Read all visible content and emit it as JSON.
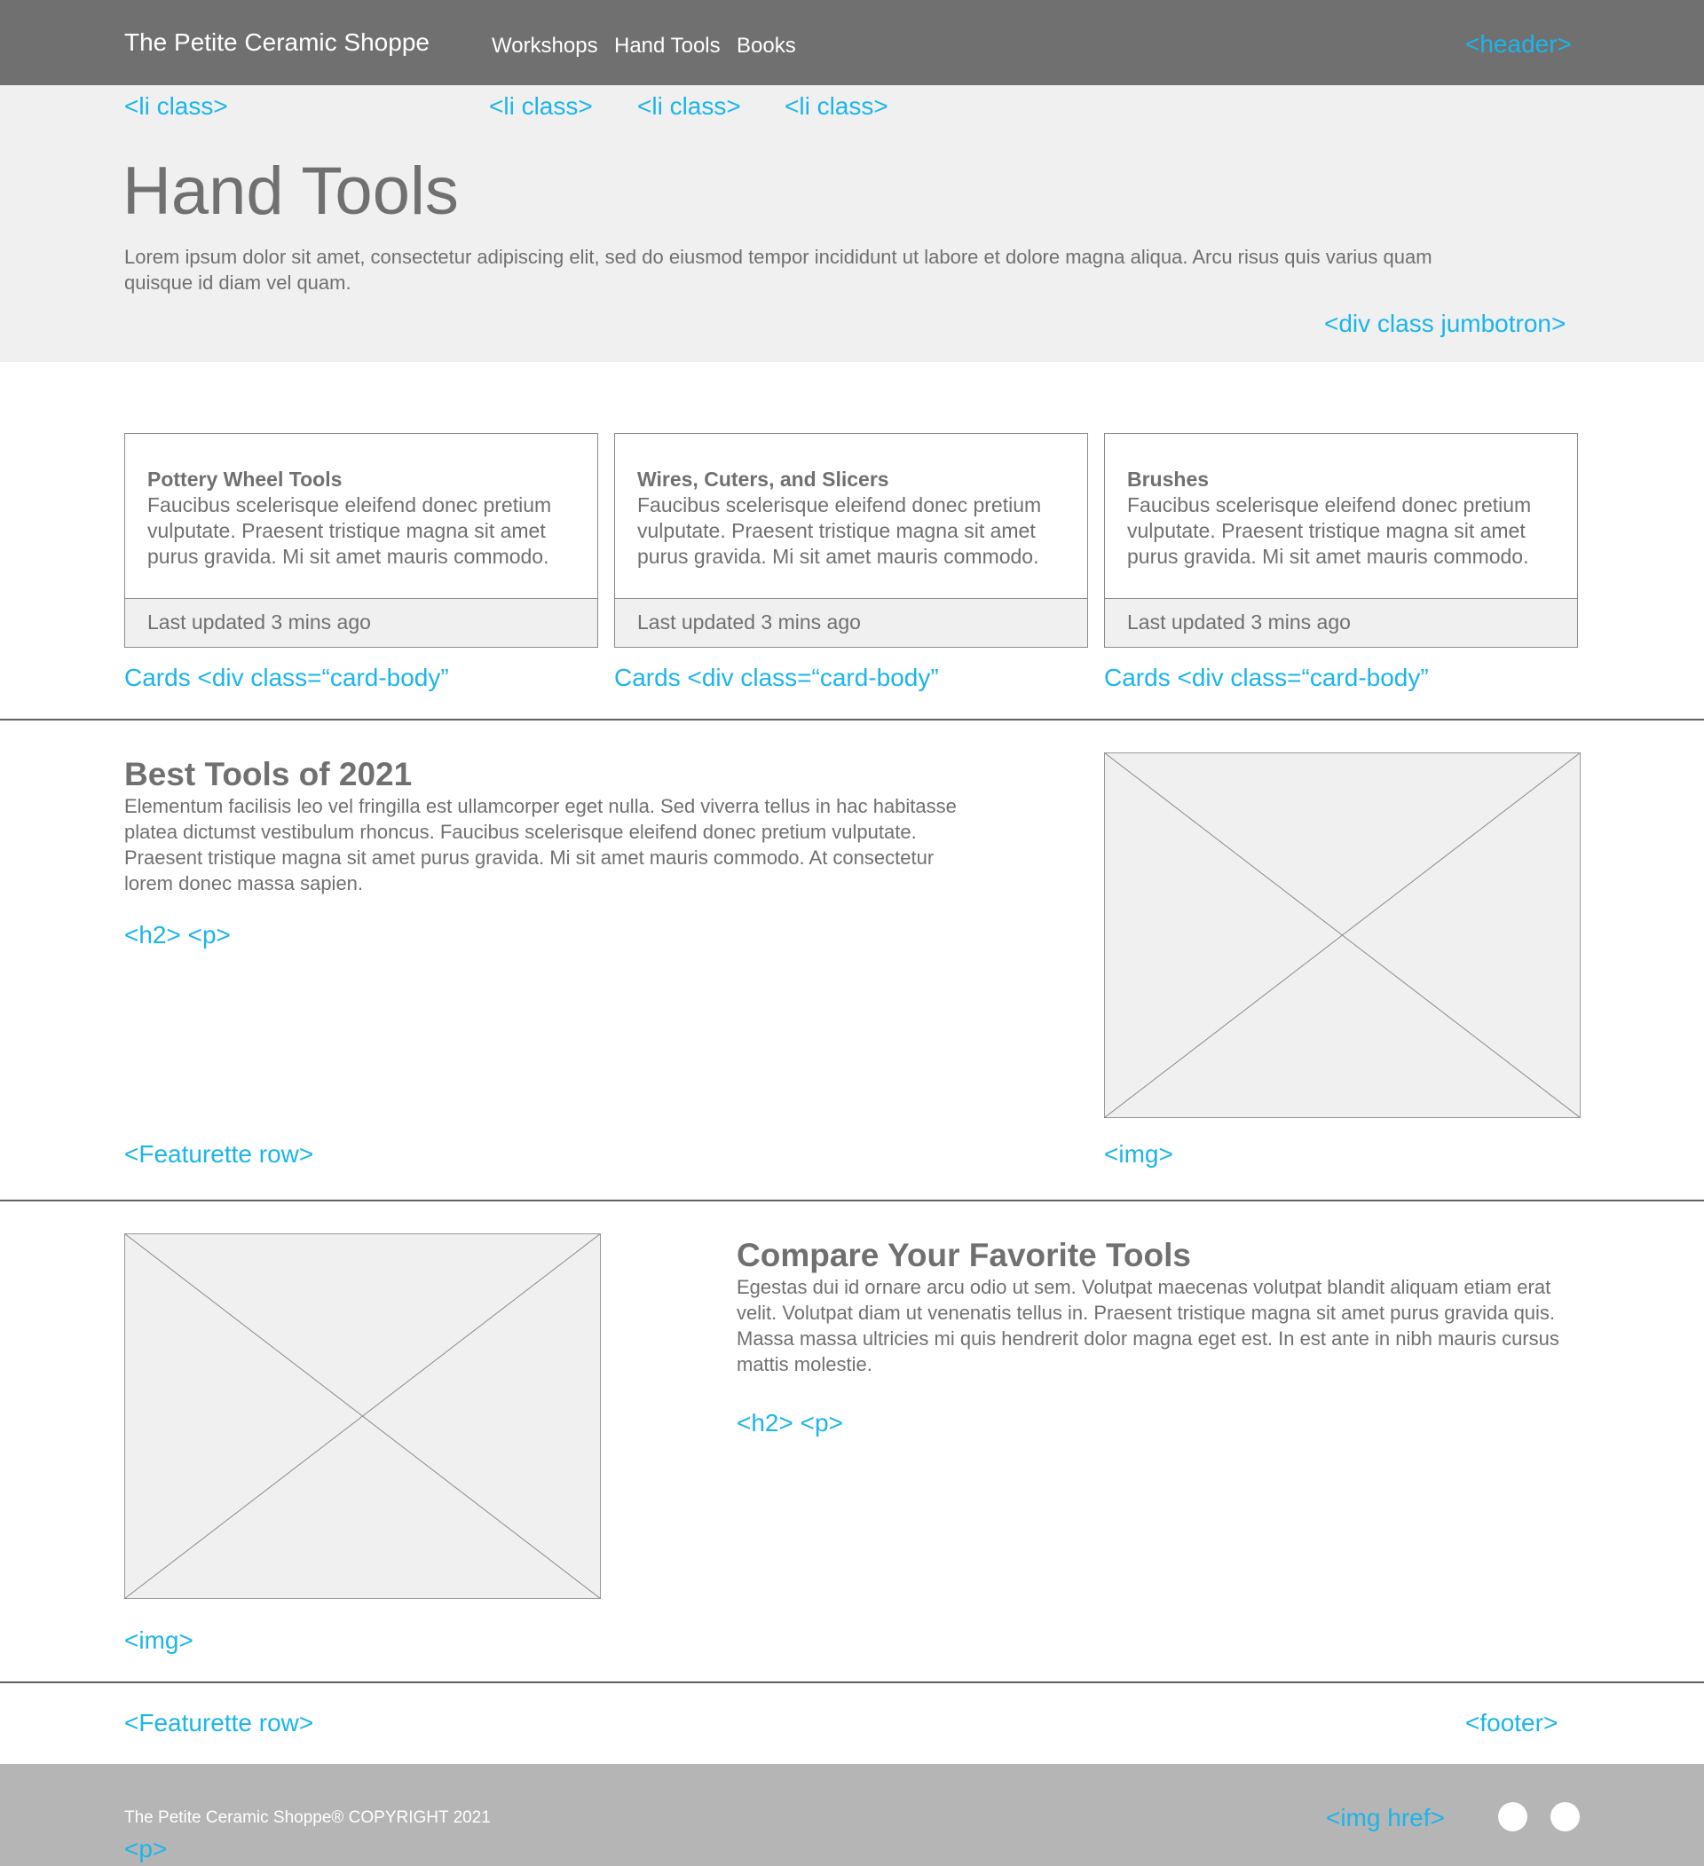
{
  "header": {
    "brand": "The Petite Ceramic Shoppe",
    "nav": [
      "Workshops",
      "Hand Tools",
      "Books"
    ]
  },
  "jumbotron": {
    "title": "Hand Tools",
    "text": "Lorem ipsum dolor sit amet, consectetur adipiscing elit, sed do eiusmod tempor incididunt ut labore et dolore magna aliqua. Arcu risus quis varius quam quisque id diam vel quam."
  },
  "cards": [
    {
      "title": "Pottery Wheel Tools",
      "text": "Faucibus scelerisque eleifend donec pretium vulputate. Praesent tristique magna sit amet purus gravida. Mi sit amet mauris commodo.",
      "footer": "Last updated 3 mins ago"
    },
    {
      "title": "Wires, Cuters, and Slicers",
      "text": "Faucibus scelerisque eleifend donec pretium vulputate. Praesent tristique magna sit amet purus gravida. Mi sit amet mauris commodo.",
      "footer": "Last updated 3 mins ago"
    },
    {
      "title": "Brushes",
      "text": "Faucibus scelerisque eleifend donec pretium vulputate. Praesent tristique magna sit amet purus gravida. Mi sit amet mauris commodo.",
      "footer": "Last updated 3 mins ago"
    }
  ],
  "featurettes": [
    {
      "title": "Best Tools of 2021",
      "text": "Elementum facilisis leo vel fringilla est ullamcorper eget nulla. Sed viverra tellus in hac habitasse platea dictumst vestibulum rhoncus. Faucibus scelerisque eleifend donec pretium vulputate. Praesent tristique magna sit amet purus gravida. Mi sit amet mauris commodo. At consectetur lorem donec massa sapien."
    },
    {
      "title": "Compare Your Favorite Tools",
      "text": "Egestas dui id ornare arcu odio ut sem. Volutpat maecenas volutpat blandit aliquam etiam erat velit. Volutpat diam ut venenatis tellus in. Praesent tristique magna sit amet purus gravida quis. Massa massa ultricies mi quis hendrerit dolor magna eget est. In est ante in nibh mauris cursus mattis molestie."
    }
  ],
  "footer": {
    "copyright": "The Petite Ceramic Shoppe® COPYRIGHT 2021",
    "social_icons": [
      "social-icon",
      "social-icon"
    ]
  },
  "annotations": {
    "header": "<header>",
    "li_class": "<li class>",
    "jumbotron": "<div class jumbotron>",
    "card_body": "Cards <div class=“card-body”",
    "h2_p": "<h2> <p>",
    "featurette_row": "<Featurette row>",
    "img": "<img>",
    "footer": "<footer>",
    "img_href": "<img href>",
    "p": "<p>"
  },
  "colors": {
    "header_bg": "#707070",
    "jumbotron_bg": "#f0f0f0",
    "footer_bg": "#b5b5b5",
    "text": "#707070",
    "annotation": "#1bb5ea"
  }
}
